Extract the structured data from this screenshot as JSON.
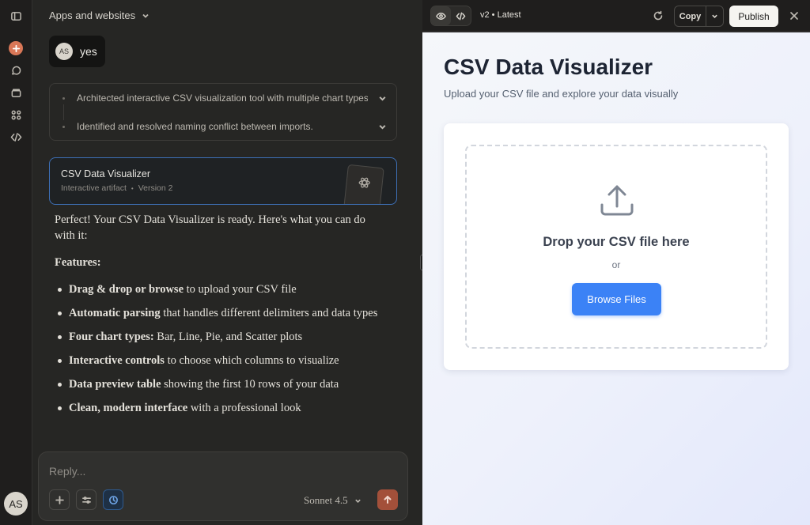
{
  "rail": {
    "avatar_initials": "AS",
    "icons": [
      "sidebar-toggle-icon",
      "plus-icon",
      "chat-search-icon",
      "projects-icon",
      "artifacts-icon",
      "code-icon"
    ]
  },
  "chat": {
    "title": "Apps and websites",
    "user_message": {
      "initials": "AS",
      "text": "yes"
    },
    "thinking_steps": [
      "Architected interactive CSV visualization tool with multiple chart types",
      "Identified and resolved naming conflict between imports."
    ],
    "artifact": {
      "title": "CSV Data Visualizer",
      "type": "Interactive artifact",
      "version": "Version 2"
    },
    "response": {
      "intro": "Perfect! Your CSV Data Visualizer is ready. Here's what you can do with it:",
      "features_heading": "Features:",
      "features": [
        {
          "bold": "Drag & drop or browse",
          "rest": " to upload your CSV file"
        },
        {
          "bold": "Automatic parsing",
          "rest": " that handles different delimiters and data types"
        },
        {
          "bold": "Four chart types:",
          "rest": " Bar, Line, Pie, and Scatter plots"
        },
        {
          "bold": "Interactive controls",
          "rest": " to choose which columns to visualize"
        },
        {
          "bold": "Data preview table",
          "rest": " showing the first 10 rows of your data"
        },
        {
          "bold": "Clean, modern interface",
          "rest": " with a professional look"
        }
      ]
    },
    "composer": {
      "placeholder": "Reply...",
      "model": "Sonnet 4.5"
    }
  },
  "panel": {
    "version_label": "v2 • Latest",
    "copy_label": "Copy",
    "publish_label": "Publish",
    "preview": {
      "title": "CSV Data Visualizer",
      "subtitle": "Upload your CSV file and explore your data visually",
      "drop_text": "Drop your CSV file here",
      "or_text": "or",
      "browse_label": "Browse Files"
    },
    "colors": {
      "primary_button": "#3b82f6",
      "artifact_border": "#3d6fb5",
      "send_button": "#a3503a"
    }
  }
}
